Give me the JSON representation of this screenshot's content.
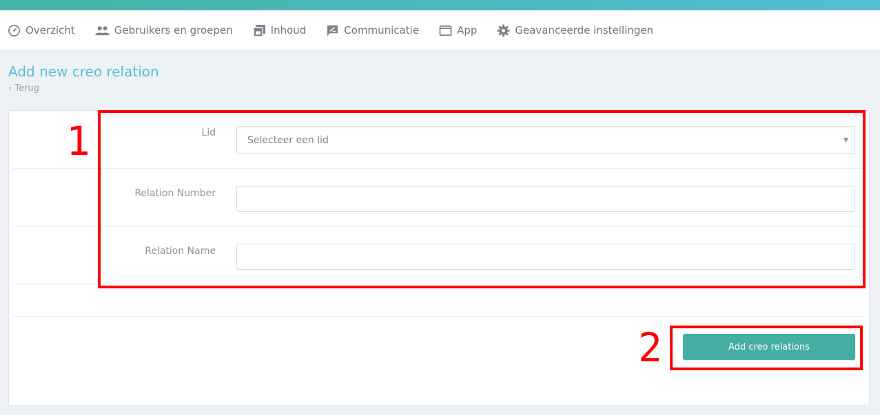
{
  "nav": {
    "items": [
      {
        "label": "Overzicht",
        "icon": "dashboard-gauge-icon"
      },
      {
        "label": "Gebruikers en groepen",
        "icon": "users-group-icon"
      },
      {
        "label": "Inhoud",
        "icon": "content-stack-icon"
      },
      {
        "label": "Communicatie",
        "icon": "message-icon"
      },
      {
        "label": "App",
        "icon": "app-window-icon"
      },
      {
        "label": "Geavanceerde instellingen",
        "icon": "gear-icon"
      }
    ]
  },
  "page": {
    "title": "Add new creo relation",
    "back_link": "‹ Terug"
  },
  "form": {
    "lid_label": "Lid",
    "lid_placeholder": "Selecteer een lid",
    "relation_number_label": "Relation Number",
    "relation_number_value": "",
    "relation_name_label": "Relation Name",
    "relation_name_value": "",
    "submit_label": "Add creo relations"
  },
  "annotations": {
    "box1_number": "1",
    "box2_number": "2"
  },
  "colors": {
    "accent_bar": "#4db8c2",
    "title": "#5bbcd6",
    "primary_button": "#46ada3",
    "annotation_red": "#ff0000"
  }
}
